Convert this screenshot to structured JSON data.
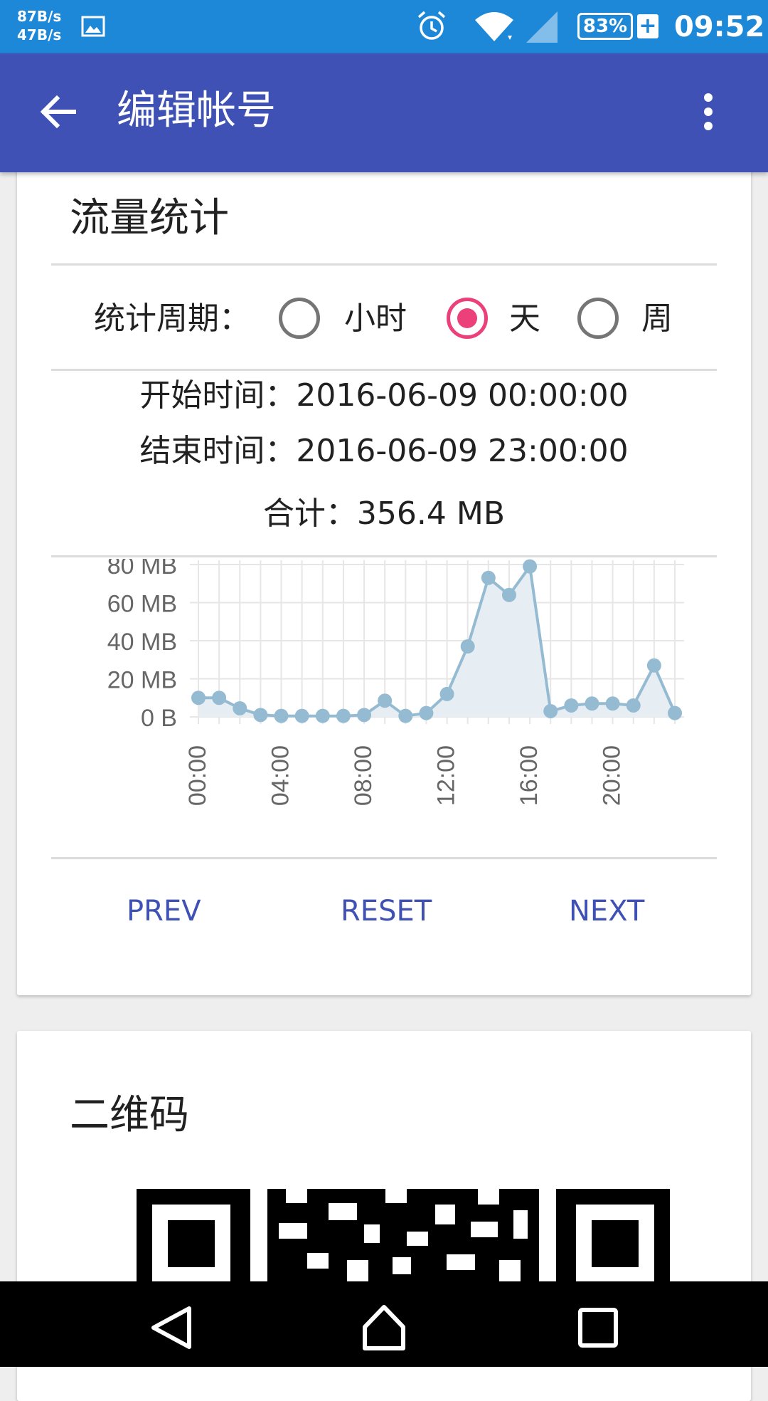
{
  "status_bar": {
    "net_up": "87B/s",
    "net_down": "47B/s",
    "battery": "83%",
    "battery_plus": "+",
    "time": "09:52",
    "icons": [
      "image-icon",
      "alarm-icon",
      "wifi-icon",
      "signal-icon",
      "battery-icon"
    ]
  },
  "app_bar": {
    "title": "编辑帐号",
    "icons": [
      "back-arrow-icon",
      "more-vert-icon"
    ]
  },
  "traffic_card": {
    "title": "流量统计",
    "period_label": "统计周期：",
    "period_options": [
      {
        "label": "小时",
        "selected": false
      },
      {
        "label": "天",
        "selected": true
      },
      {
        "label": "周",
        "selected": false
      }
    ],
    "start_time": "开始时间：2016-06-09 00:00:00",
    "end_time": "结束时间：2016-06-09 23:00:00",
    "total": "合计：356.4 MB",
    "buttons": {
      "prev": "PREV",
      "reset": "RESET",
      "next": "NEXT"
    }
  },
  "chart_data": {
    "type": "area",
    "x": [
      "00:00",
      "01:00",
      "02:00",
      "03:00",
      "04:00",
      "05:00",
      "06:00",
      "07:00",
      "08:00",
      "09:00",
      "10:00",
      "11:00",
      "12:00",
      "13:00",
      "14:00",
      "15:00",
      "16:00",
      "17:00",
      "18:00",
      "19:00",
      "20:00",
      "21:00",
      "22:00",
      "23:00"
    ],
    "values": [
      10,
      10,
      4.5,
      1,
      0.5,
      0.5,
      0.5,
      0.5,
      1,
      8.5,
      0.5,
      2,
      12,
      37,
      73,
      64,
      79,
      3,
      6,
      7,
      7,
      6,
      27,
      2
    ],
    "unit": "MB",
    "ylim": [
      0,
      80
    ],
    "y_ticks": [
      "0 B",
      "20 MB",
      "40 MB",
      "60 MB",
      "80 MB"
    ],
    "x_ticks": [
      "00:00",
      "04:00",
      "08:00",
      "12:00",
      "16:00",
      "20:00"
    ],
    "grid": true,
    "colors": {
      "line": "#95bbd2",
      "fill": "#e6eef3",
      "grid": "#e6e6e6"
    }
  },
  "qr_card": {
    "title": "二维码"
  },
  "nav_bar": {
    "icons": [
      "back-triangle-icon",
      "home-icon",
      "recents-icon"
    ]
  }
}
